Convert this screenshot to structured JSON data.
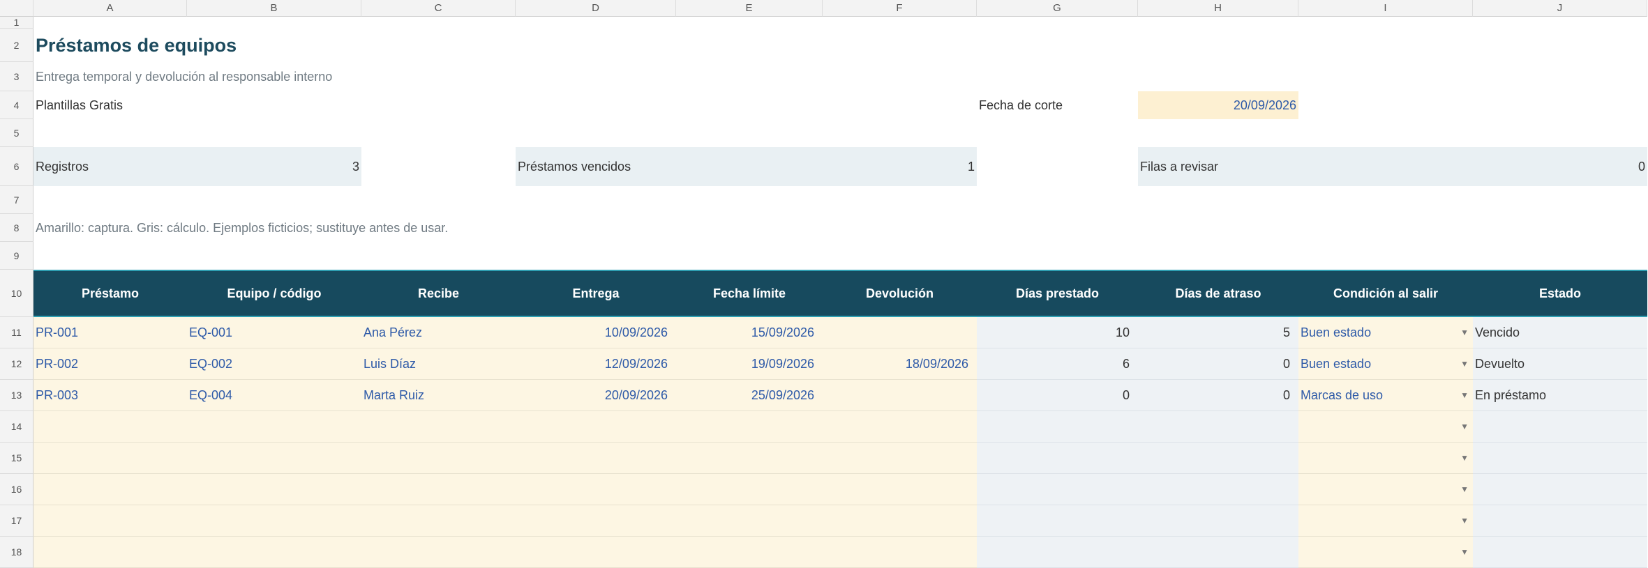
{
  "columns": [
    "A",
    "B",
    "C",
    "D",
    "E",
    "F",
    "G",
    "H",
    "I",
    "J"
  ],
  "rows": [
    "1",
    "2",
    "3",
    "4",
    "5",
    "6",
    "7",
    "8",
    "9",
    "10",
    "11",
    "12",
    "13",
    "14",
    "15",
    "16",
    "17",
    "18"
  ],
  "title": "Préstamos de equipos",
  "subtitle": "Entrega temporal y devolución al responsable interno",
  "company": "Plantillas Gratis",
  "cutoff": {
    "label": "Fecha de corte",
    "value": "20/09/2026"
  },
  "kpis": [
    {
      "label": "Registros",
      "value": "3"
    },
    {
      "label": "Préstamos vencidos",
      "value": "1"
    },
    {
      "label": "Filas a revisar",
      "value": "0"
    }
  ],
  "note": "Amarillo: captura. Gris: cálculo. Ejemplos ficticios; sustituye antes de usar.",
  "table": {
    "headers": [
      "Préstamo",
      "Equipo / código",
      "Recibe",
      "Entrega",
      "Fecha límite",
      "Devolución",
      "Días prestado",
      "Días de atraso",
      "Condición al salir",
      "Estado"
    ],
    "rows": [
      [
        "PR-001",
        "EQ-001",
        "Ana Pérez",
        "10/09/2026",
        "15/09/2026",
        "",
        "10",
        "5",
        "Buen estado",
        "Vencido"
      ],
      [
        "PR-002",
        "EQ-002",
        "Luis Díaz",
        "12/09/2026",
        "19/09/2026",
        "18/09/2026",
        "6",
        "0",
        "Buen estado",
        "Devuelto"
      ],
      [
        "PR-003",
        "EQ-004",
        "Marta Ruiz",
        "20/09/2026",
        "25/09/2026",
        "",
        "0",
        "0",
        "Marcas de uso",
        "En préstamo"
      ]
    ]
  },
  "colors": {
    "header_bg": "#174a5e",
    "input_bg": "#fdf6e3",
    "calc_bg": "#eef2f5",
    "overdue_bg": "#fde4e7",
    "value_text": "#2e5aa8"
  },
  "icons": {
    "dropdown": "dropdown-arrow-icon"
  }
}
